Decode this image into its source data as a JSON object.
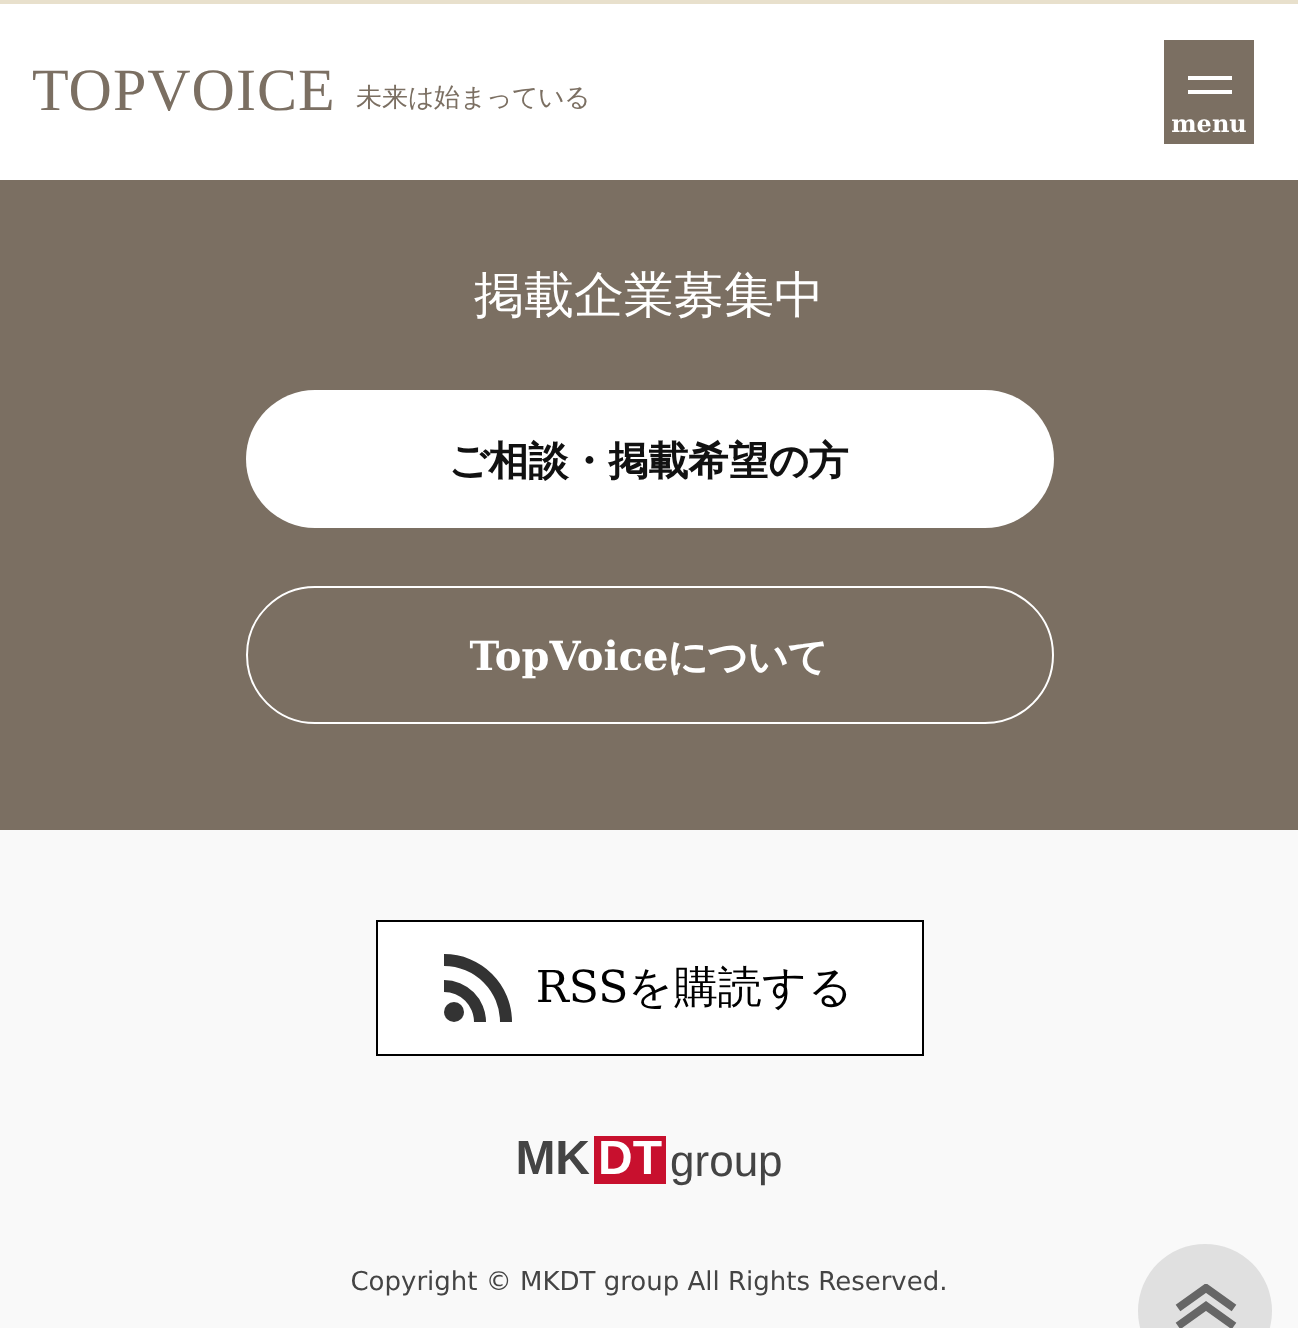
{
  "header": {
    "logo": "TOPVOICE",
    "tagline": "未来は始まっている",
    "menu_label": "menu"
  },
  "recruit": {
    "title": "掲載企業募集中",
    "buttons": [
      {
        "label": "ご相談・掲載希望の方",
        "kind": "filled"
      },
      {
        "label": "TopVoiceについて",
        "kind": "outline"
      }
    ]
  },
  "footer": {
    "rss_label": "RSSを購読する",
    "group_logo": {
      "left": "MK",
      "mark": "DT",
      "right": "group"
    },
    "copyright": "Copyright © MKDT group All Rights Reserved."
  }
}
